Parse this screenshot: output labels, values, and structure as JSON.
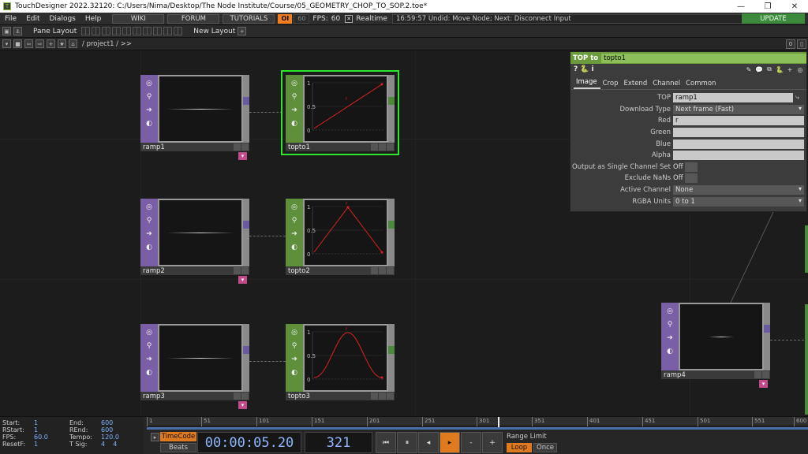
{
  "titlebar": {
    "icon": "td-logo-icon",
    "title": "TouchDesigner 2022.32120: C:/Users/Nima/Desktop/The Node Institute/Course/05_GEOMETRY_CHOP_TO_SOP.2.toe*",
    "minimize": "—",
    "maximize": "❐",
    "close": "✕"
  },
  "menubar": {
    "items": [
      "File",
      "Edit",
      "Dialogs",
      "Help"
    ],
    "wiki": "WIKI",
    "forum": "FORUM",
    "tutorials": "TUTORIALS",
    "op_badge": "OI",
    "fps_box": "60",
    "fps_label": "FPS:",
    "fps_value": "60",
    "realtime_check": "✕",
    "realtime_label": "Realtime",
    "status": "16:59:57 Undid: Move Node; Next: Disconnect Input",
    "update": "UPDATE"
  },
  "panebar": {
    "pane_layout": "Pane Layout",
    "new_layout": "New Layout",
    "add": "+"
  },
  "pathbar": {
    "path": "/ project1 / >>",
    "right_zero": "0"
  },
  "nodes": {
    "ramp1": "ramp1",
    "ramp2": "ramp2",
    "ramp3": "ramp3",
    "ramp4": "ramp4",
    "topto1": "topto1",
    "topto2": "topto2",
    "topto3": "topto3"
  },
  "graph_labels": {
    "y_top": "1",
    "y_mid": "0.5",
    "y_zero": "0",
    "channel": "r"
  },
  "colors": {
    "chop_node": "#7a5fa6",
    "top_node": "#5f8f3b",
    "selected": "#2ee62e",
    "curve": "#e02020",
    "accent_orange": "#e07a1e",
    "timecode_text": "#8fb7ff"
  },
  "param": {
    "type_label": "TOP to",
    "node_name": "topto1",
    "icons": {
      "help": "?",
      "python": "🐍",
      "info": "i"
    },
    "tabs": [
      "Image",
      "Crop",
      "Extend",
      "Channel",
      "Common"
    ],
    "active_tab": "Image",
    "rows": {
      "top_label": "TOP",
      "top_value": "ramp1",
      "download_label": "Download Type",
      "download_value": "Next frame (Fast)",
      "red_label": "Red",
      "red_value": "r",
      "green_label": "Green",
      "green_value": "",
      "blue_label": "Blue",
      "blue_value": "",
      "alpha_label": "Alpha",
      "alpha_value": "",
      "single_label": "Output as Single Channel Set",
      "single_value": "Off",
      "nans_label": "Exclude NaNs",
      "nans_value": "Off",
      "active_label": "Active Channel",
      "active_value": "None",
      "rgba_label": "RGBA Units",
      "rgba_value": "0 to 1"
    }
  },
  "timeline": {
    "start_label": "Start:",
    "start_value": "1",
    "end_label": "End:",
    "end_value": "600",
    "rstart_label": "RStart:",
    "rstart_value": "1",
    "rend_label": "REnd:",
    "rend_value": "600",
    "fps_label": "FPS:",
    "fps_value": "60.0",
    "tempo_label": "Tempo:",
    "tempo_value": "120.0",
    "reset_label": "ResetF:",
    "reset_value": "1",
    "tsig_label": "T Sig:",
    "tsig_a": "4",
    "tsig_b": "4",
    "ticks": [
      "1",
      "51",
      "101",
      "151",
      "201",
      "251",
      "301",
      "351",
      "401",
      "451",
      "501",
      "551",
      "600"
    ],
    "timecode_btn": "TimeCode",
    "beats_btn": "Beats",
    "timecode": "00:00:05.20",
    "frame": "321",
    "btn_rewind": "⏮",
    "btn_pause": "⏸",
    "btn_back": "◂",
    "btn_play": "▸",
    "btn_minus": "-",
    "btn_plus": "+",
    "range_limit": "Range Limit",
    "loop": "Loop",
    "once": "Once"
  }
}
